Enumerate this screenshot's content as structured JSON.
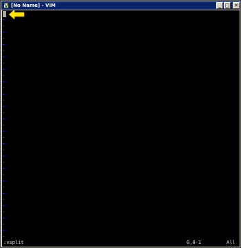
{
  "window": {
    "title": "[No Name] - VIM",
    "min_label": "_",
    "max_label": "□",
    "close_label": "✕",
    "icon": "vim-icon"
  },
  "editor": {
    "tilde_char": "~",
    "tilde_rows": 36,
    "tilde_color": "#3030ff",
    "background": "#000000",
    "cursor_color": "#a8a8a8",
    "annotation": "yellow-arrow-icon",
    "annotation_color": "#ffe600"
  },
  "statusline": {
    "command": ":vsplit",
    "position": "0,0-1",
    "scroll": "All"
  }
}
